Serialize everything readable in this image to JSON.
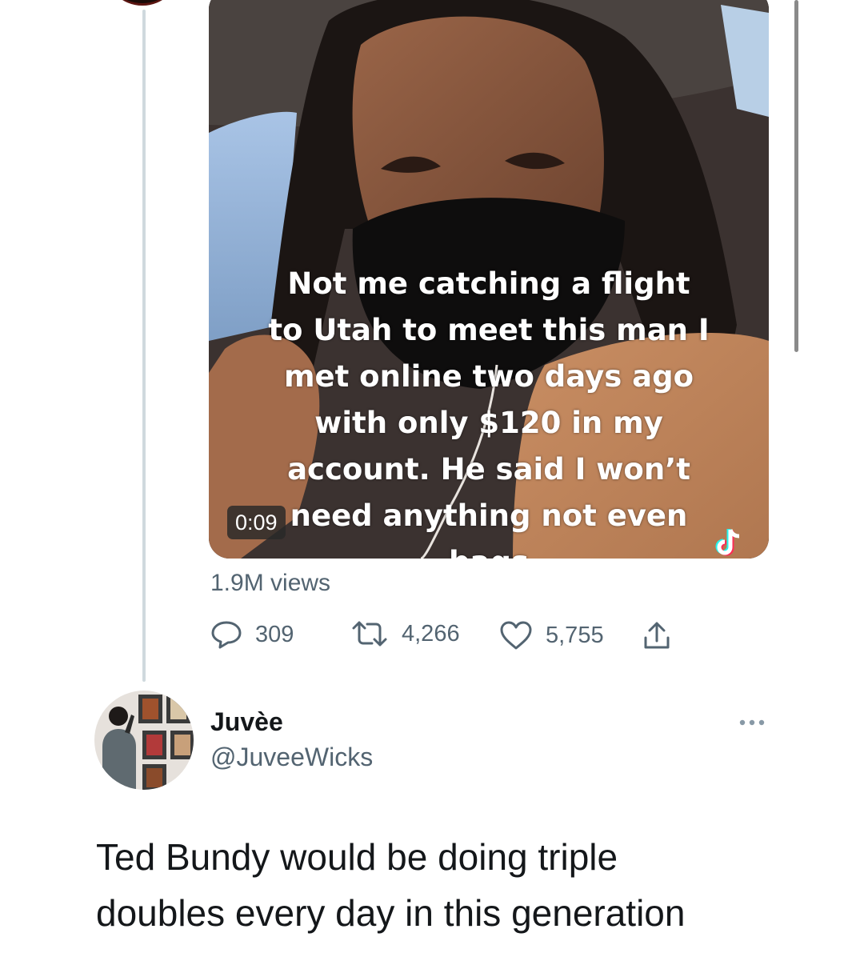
{
  "tweet": {
    "video": {
      "caption_lines": [
        "Not me catching a flight",
        "to Utah to meet this man I",
        "met online two days ago",
        "with only $120 in my",
        "account. He said I won’t",
        "need anything not even",
        "bags"
      ],
      "timestamp": "0:09",
      "watermark_icon": "tiktok-logo-icon"
    },
    "views": "1.9M views",
    "actions": {
      "reply_count": "309",
      "retweet_count": "4,266",
      "like_count": "5,755"
    }
  },
  "reply": {
    "display_name": "Juvèe",
    "handle": "@JuveeWicks",
    "text_lines": [
      "Ted Bundy would be doing triple",
      "doubles every day in this generation"
    ]
  },
  "colors": {
    "secondary_text": "#536471",
    "thread_line": "#cfd9de",
    "primary_text": "#14171a"
  }
}
